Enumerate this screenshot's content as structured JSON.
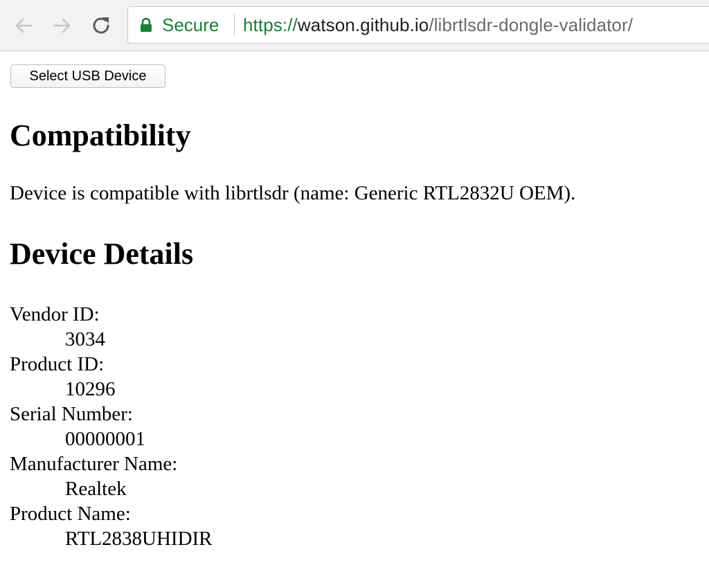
{
  "browser": {
    "security_label": "Secure",
    "url_scheme": "https://",
    "url_host": "watson.github.io",
    "url_path": "/librtlsdr-dongle-validator/",
    "secure_color": "#1a7f37",
    "icons": {
      "back": "arrow-left-icon",
      "forward": "arrow-right-icon",
      "reload": "reload-icon",
      "lock": "lock-icon"
    }
  },
  "page": {
    "select_button_label": "Select USB Device",
    "compatibility_heading": "Compatibility",
    "compatibility_text": "Device is compatible with librtlsdr (name: Generic RTL2832U OEM).",
    "details_heading": "Device Details",
    "details": [
      {
        "label": "Vendor ID:",
        "value": "3034"
      },
      {
        "label": "Product ID:",
        "value": "10296"
      },
      {
        "label": "Serial Number:",
        "value": "00000001"
      },
      {
        "label": "Manufacturer Name:",
        "value": "Realtek"
      },
      {
        "label": "Product Name:",
        "value": "RTL2838UHIDIR"
      }
    ]
  }
}
